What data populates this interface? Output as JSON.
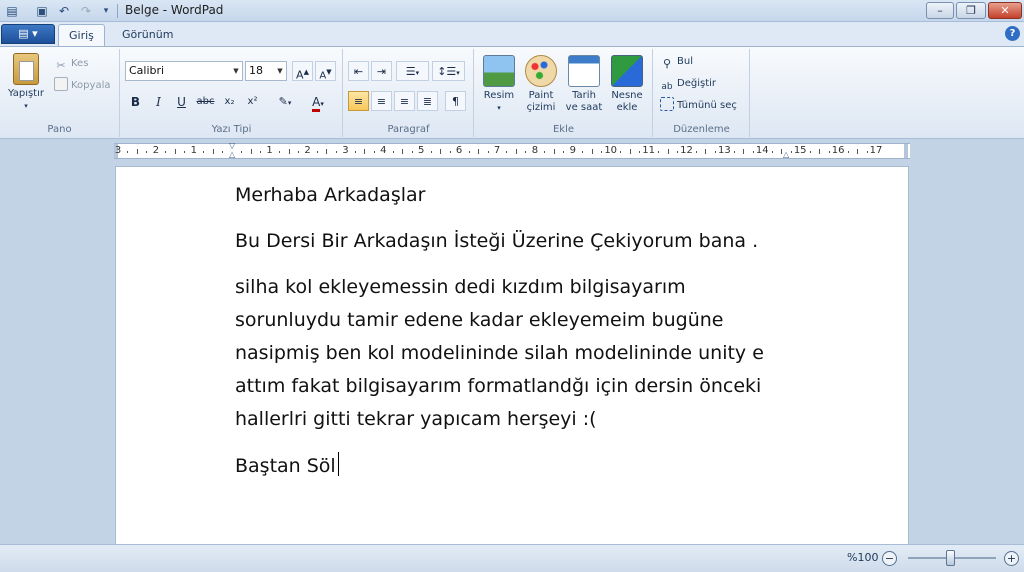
{
  "window": {
    "title": "Belge - WordPad"
  },
  "tabs": [
    {
      "label": "Giriş"
    },
    {
      "label": "Görünüm"
    }
  ],
  "ribbon": {
    "clipboard": {
      "group_label": "Pano",
      "paste": "Yapıştır",
      "cut": "Kes",
      "copy": "Kopyala"
    },
    "font": {
      "group_label": "Yazı Tipi",
      "family": "Calibri",
      "size": "18"
    },
    "paragraph": {
      "group_label": "Paragraf"
    },
    "insert": {
      "group_label": "Ekle",
      "picture": "Resim",
      "paint_1": "Paint",
      "paint_2": "çizimi",
      "datetime_1": "Tarih",
      "datetime_2": "ve saat",
      "object_1": "Nesne",
      "object_2": "ekle"
    },
    "editing": {
      "group_label": "Düzenleme",
      "find": "Bul",
      "replace": "Değiştir",
      "select_all": "Tümünü seç"
    }
  },
  "ruler": {
    "labels": [
      "3",
      "2",
      "1",
      "",
      "1",
      "2",
      "3",
      "4",
      "5",
      "6",
      "7",
      "8",
      "9",
      "10",
      "11",
      "12",
      "13",
      "14",
      "15",
      "16",
      "17"
    ]
  },
  "document": {
    "line1": "Merhaba Arkadaşlar",
    "line2": "Bu Dersi Bir Arkadaşın İsteği Üzerine Çekiyorum bana .",
    "para3": [
      "silha kol ekleyemessin dedi kızdım bilgisayarım",
      "sorunluydu tamir edene kadar ekleyemeim bugüne",
      "nasipmiş ben kol modelininde silah modelininde unity e",
      "attım fakat bilgisayarım formatlandğı için dersin önceki",
      "hallerlri gitti tekrar yapıcam herşeyi :("
    ],
    "line4": "Baştan Söl"
  },
  "statusbar": {
    "zoom": "%100",
    "zoom_level_percent": 100
  },
  "colors": {
    "accent": "#1d4f99",
    "ribbon_bg": "#dde7f3",
    "work_bg": "#c3d3e6"
  }
}
